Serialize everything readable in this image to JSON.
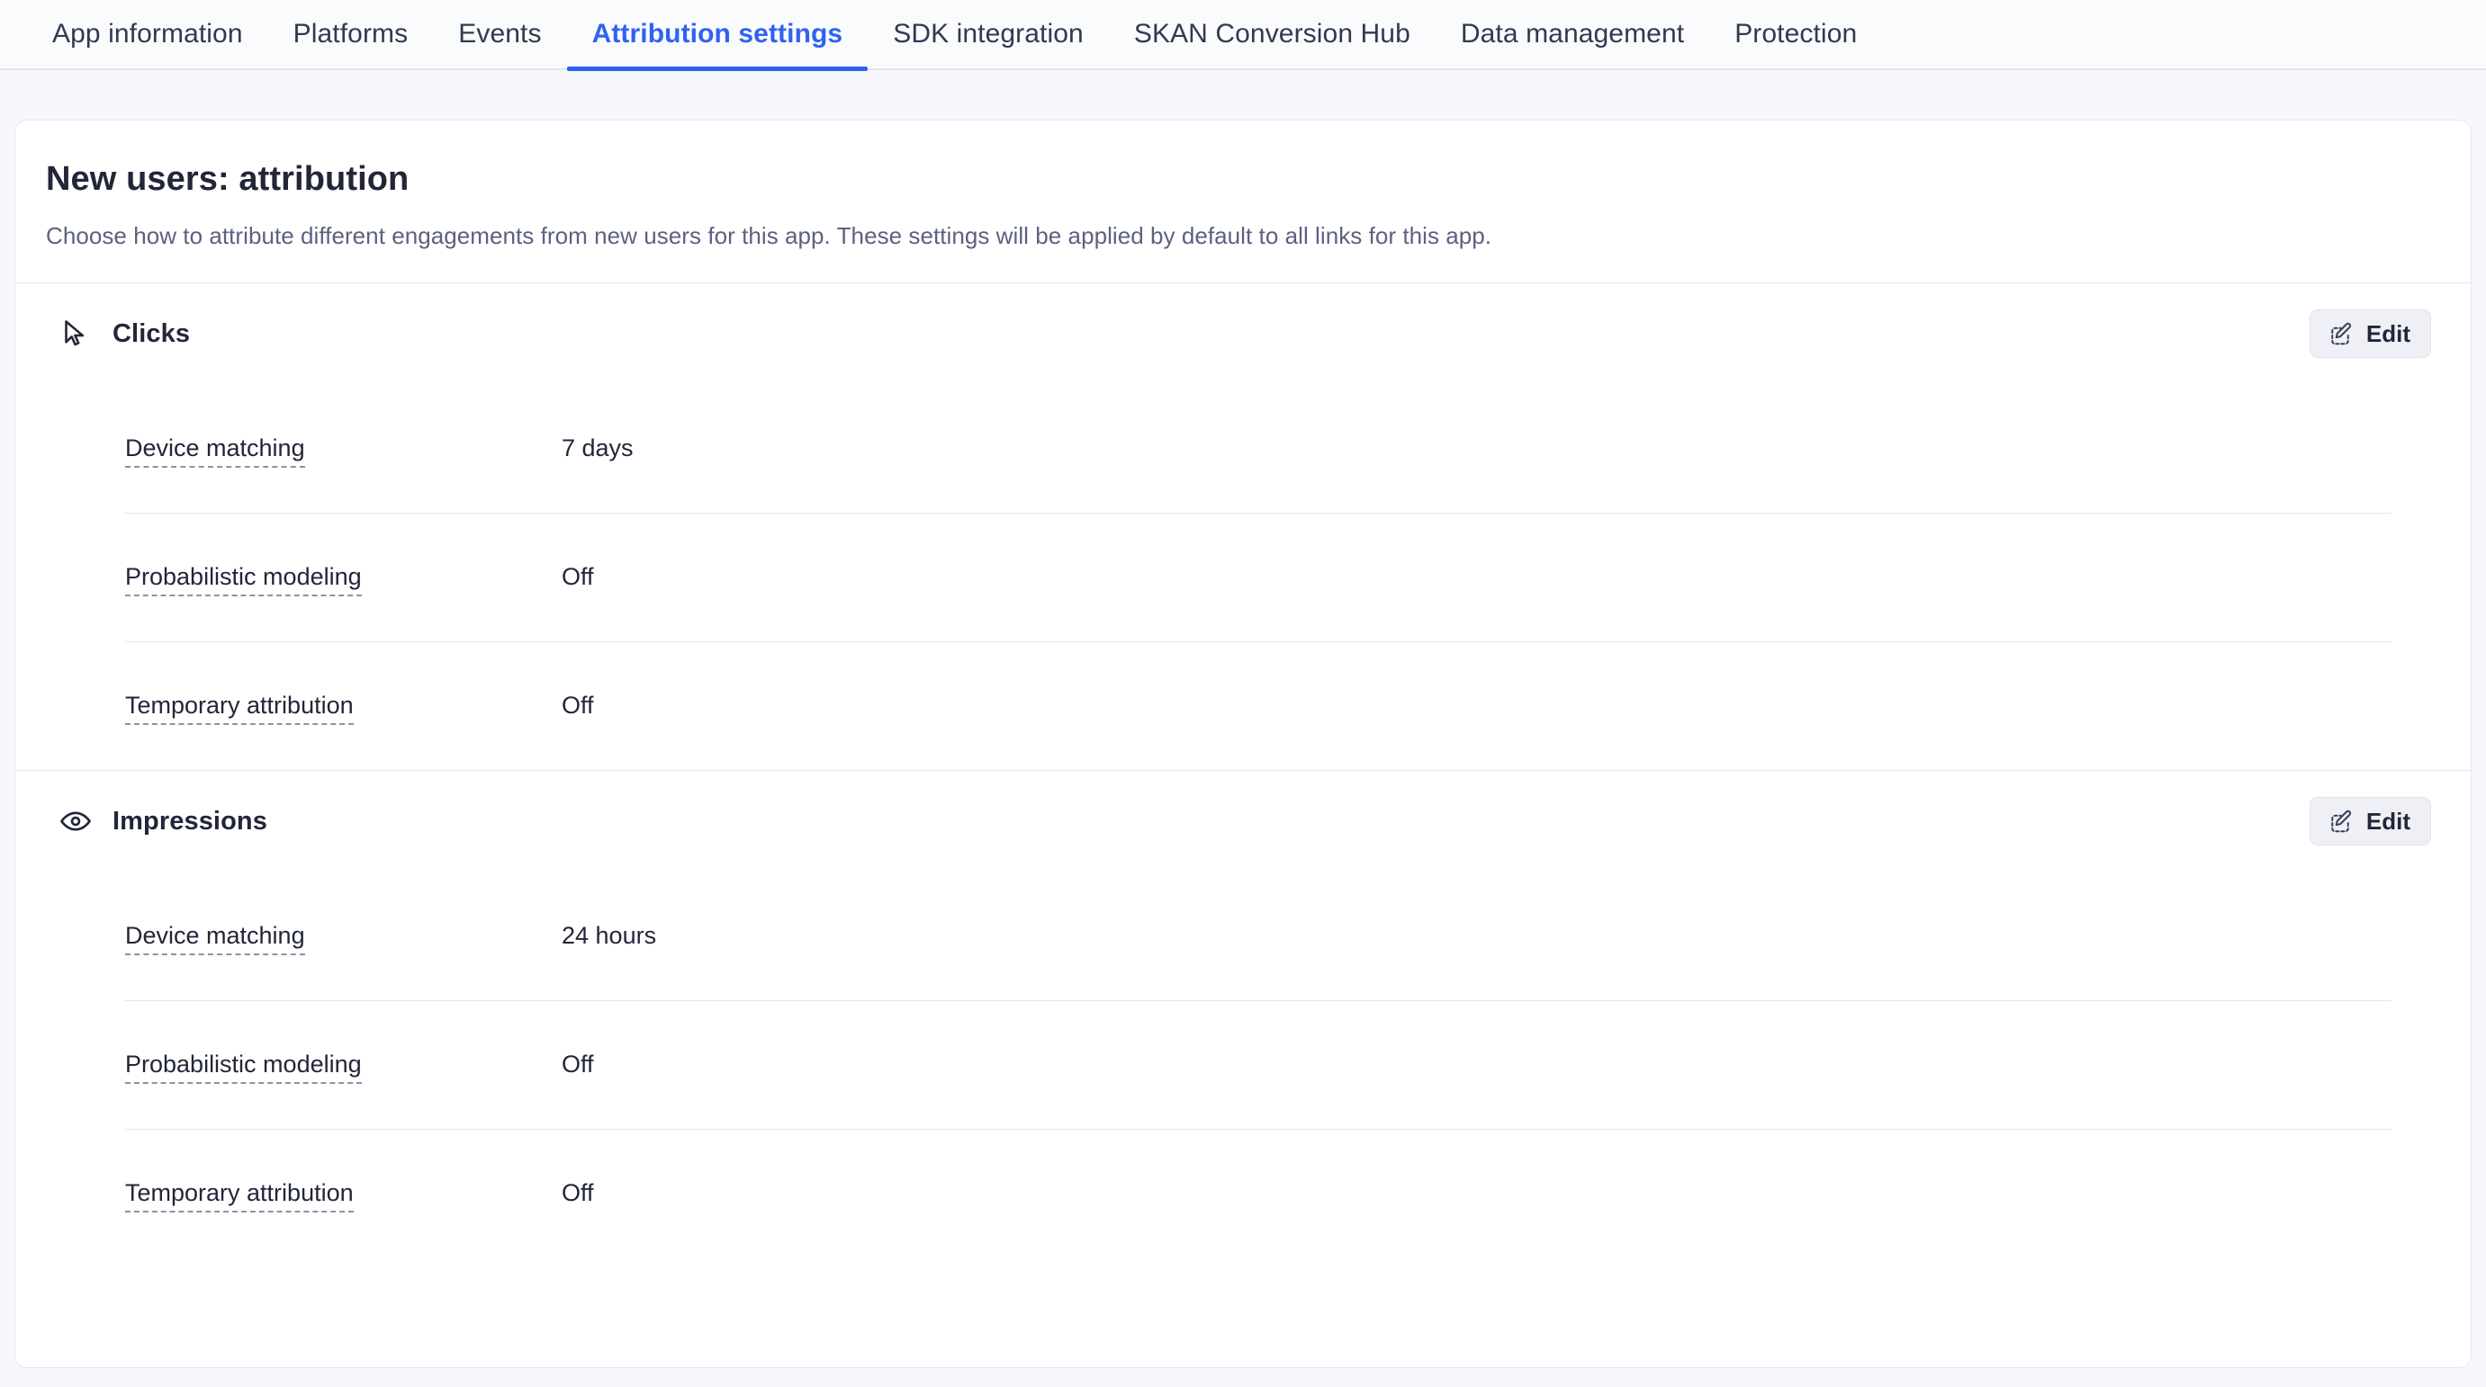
{
  "theme": {
    "accent": "#2f62f0",
    "text": "#232639",
    "muted": "#5c6180",
    "card_bg": "#ffffff",
    "page_bg": "#f7f8fb",
    "divider": "#e4e5ef",
    "button_bg": "#eef0f5"
  },
  "tabs": [
    {
      "label": "App information",
      "active": false
    },
    {
      "label": "Platforms",
      "active": false
    },
    {
      "label": "Events",
      "active": false
    },
    {
      "label": "Attribution settings",
      "active": true
    },
    {
      "label": "SDK integration",
      "active": false
    },
    {
      "label": "SKAN Conversion Hub",
      "active": false
    },
    {
      "label": "Data management",
      "active": false
    },
    {
      "label": "Protection",
      "active": false
    }
  ],
  "card": {
    "title": "New users: attribution",
    "subtitle": "Choose how to attribute different engagements from new users for this app. These settings will be applied by default to all links for this app."
  },
  "sections": [
    {
      "name": "Clicks",
      "icon": "cursor-arrow-icon",
      "edit_label": "Edit",
      "rows": [
        {
          "label": "Device matching",
          "value": "7 days"
        },
        {
          "label": "Probabilistic modeling",
          "value": "Off"
        },
        {
          "label": "Temporary attribution",
          "value": "Off"
        }
      ]
    },
    {
      "name": "Impressions",
      "icon": "eye-icon",
      "edit_label": "Edit",
      "rows": [
        {
          "label": "Device matching",
          "value": "24 hours"
        },
        {
          "label": "Probabilistic modeling",
          "value": "Off"
        },
        {
          "label": "Temporary attribution",
          "value": "Off"
        }
      ]
    }
  ]
}
